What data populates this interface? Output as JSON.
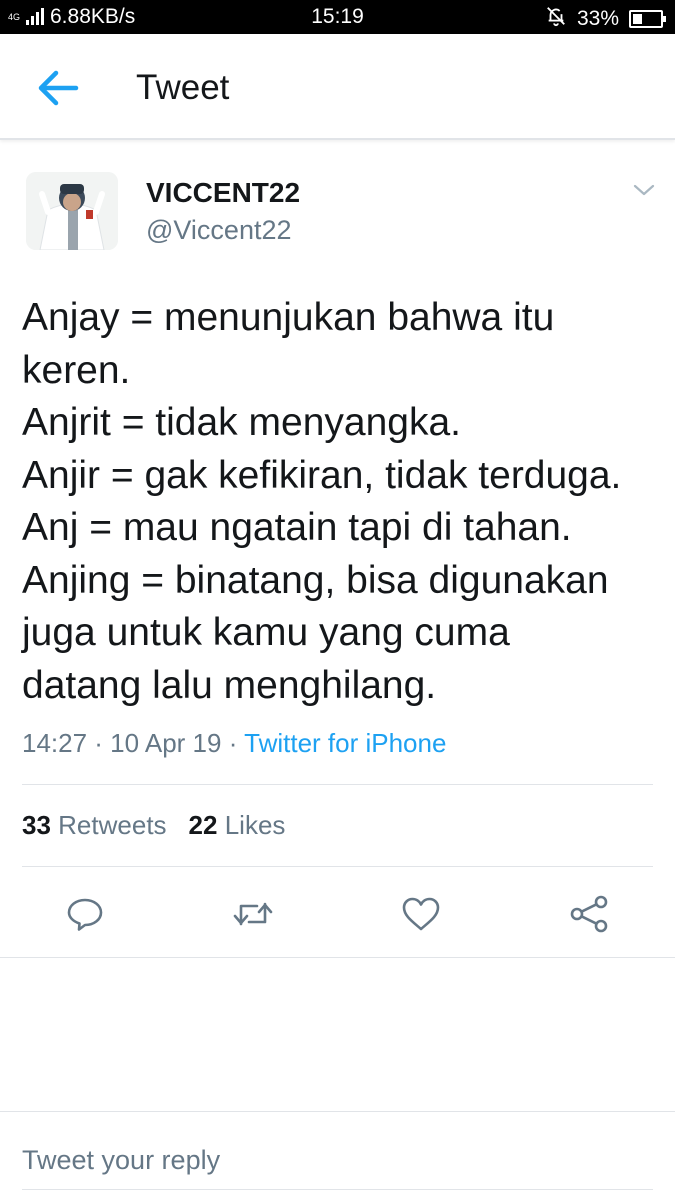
{
  "status_bar": {
    "network_type": "4G",
    "data_speed": "6.88KB/s",
    "time": "15:19",
    "battery_percent": "33%",
    "battery_level": 0.33,
    "icons": [
      "signal-icon",
      "mute-bell-icon",
      "battery-icon"
    ]
  },
  "header": {
    "title": "Tweet",
    "back_icon": "arrow-left-icon",
    "accent_color": "#1da1f2"
  },
  "tweet": {
    "display_name": "VICCENT22",
    "handle": "@Viccent22",
    "text_lines": [
      "Anjay = menunjukan bahwa itu",
      "keren.",
      "Anjrit = tidak menyangka.",
      "Anjir = gak kefikiran, tidak terduga.",
      "Anj = mau ngatain tapi di tahan.",
      "Anjing = binatang, bisa digunakan",
      "juga untuk kamu yang cuma",
      "datang lalu menghilang."
    ],
    "timestamp": "14:27 · 10 Apr 19",
    "separator": " · ",
    "source": "Twitter for iPhone",
    "retweet_count": "33",
    "retweet_label": "Retweets",
    "like_count": "22",
    "like_label": "Likes"
  },
  "actions": [
    "reply-icon",
    "retweet-icon",
    "like-icon",
    "share-icon"
  ],
  "reply": {
    "placeholder": "Tweet your reply"
  }
}
